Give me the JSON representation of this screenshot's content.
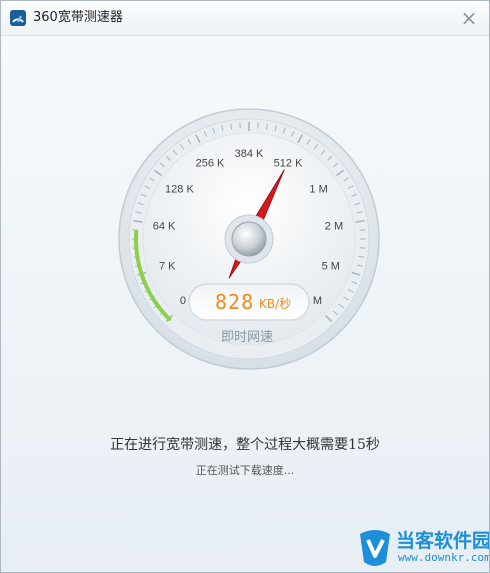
{
  "window": {
    "title": "360宽带测速器",
    "close_glyph": "×"
  },
  "gauge": {
    "scale_labels": [
      "0 K",
      "7 K",
      "64 K",
      "128 K",
      "256 K",
      "384 K",
      "512 K",
      "1 M",
      "2 M",
      "5 M",
      "10 M"
    ],
    "needle_level": 0.6,
    "progress_level": 0.18,
    "speed_value": "828",
    "speed_unit": "KB/秒",
    "label": "即时网速",
    "accent_color": "#8dce4a",
    "needle_color": "#d9161c",
    "speed_color": "#f08a1a"
  },
  "status": {
    "main": "正在进行宽带测速，整个过程大概需要15秒",
    "sub": "正在测试下载速度..."
  },
  "watermark": {
    "text": "当客软件园",
    "url": "www.downkr.com"
  },
  "icons": {
    "app": "broadband-meter-icon",
    "close": "close-icon",
    "watermark": "downkr-logo-icon"
  }
}
